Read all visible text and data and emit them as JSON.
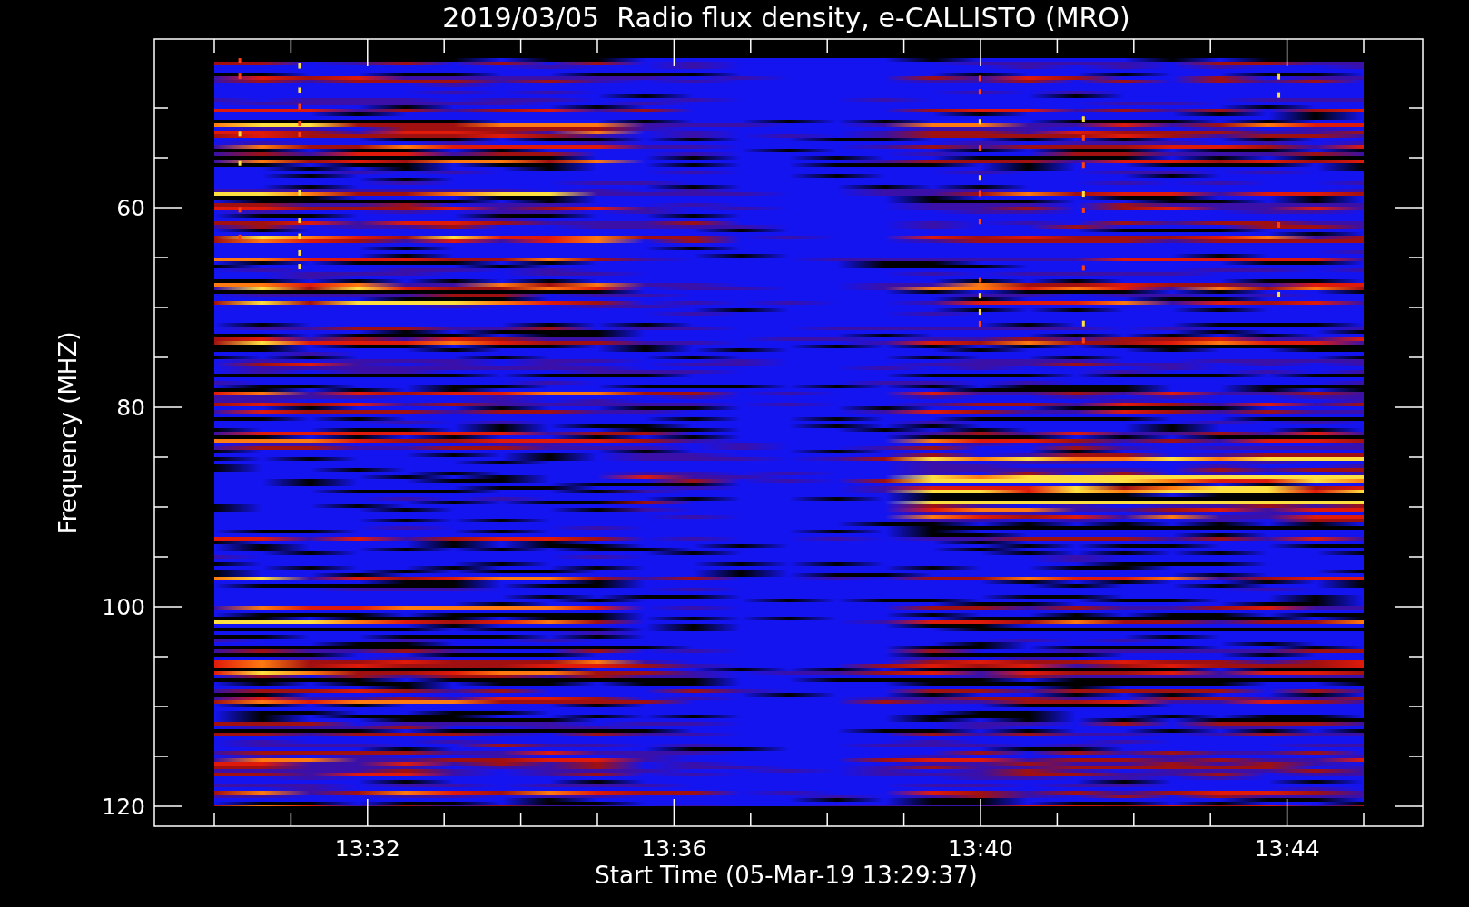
{
  "title": "2019/03/05  Radio flux density, e-CALLISTO (MRO)",
  "y_axis": {
    "label": "Frequency (MHZ)",
    "ticks": [
      "60",
      "80",
      "100",
      "120"
    ]
  },
  "x_axis": {
    "label": "Start Time (05-Mar-19 13:29:37)",
    "ticks": [
      "13:32",
      "13:36",
      "13:40",
      "13:44"
    ]
  }
}
